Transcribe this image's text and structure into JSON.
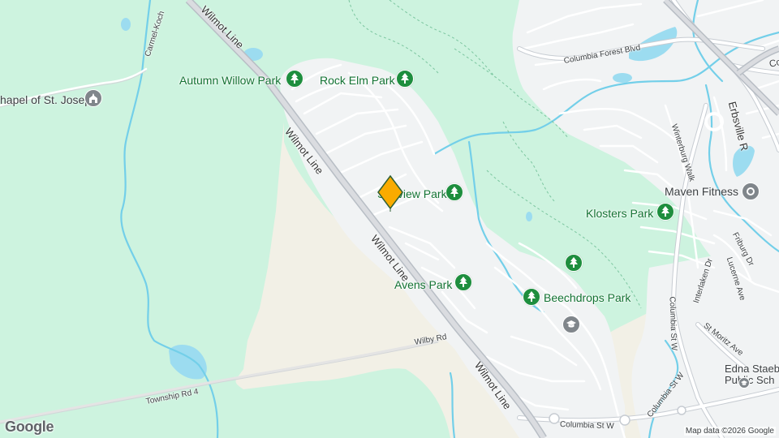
{
  "parks": [
    {
      "id": "autumn-willow",
      "label": "Autumn Willow Park"
    },
    {
      "id": "rock-elm",
      "label": "Rock Elm Park"
    },
    {
      "id": "sunview",
      "label": "Sunview Park"
    },
    {
      "id": "klosters",
      "label": "Klosters Park"
    },
    {
      "id": "avens",
      "label": "Avens Park"
    },
    {
      "id": "beechdrops",
      "label": "Beechdrops Park"
    }
  ],
  "pois": {
    "chapel": {
      "label": "hapel of St. Joseph",
      "icon": "chapel-icon"
    },
    "maven": {
      "label": "Maven Fitness",
      "icon": "fitness-icon"
    },
    "school": {
      "label_line1": "Edna Staeb",
      "label_line2": "Public Sch",
      "icon": "school-icon"
    }
  },
  "streets": {
    "wilmot_1": "Wilmot Line",
    "wilmot_2": "Wilmot Line",
    "wilmot_3": "Wilmot Line",
    "wilmot_4": "Wilmot Line",
    "carmel": "Carmel-Koch",
    "columbia_forest": "Columbia Forest Blvd",
    "erbsville": "Erbsville R",
    "co_top": "Co",
    "winterburg": "Winterburg Walk",
    "friburg": "Friburg Dr",
    "interlaken": "Interlaken Dr",
    "lucerne": "Lucerne Ave",
    "columbia_st_w_1": "Columbia St W",
    "columbia_st_w_2": "Columbia St W",
    "columbia_st_w_3": "Columbia St W",
    "st_moritz": "St Moritz Ave",
    "wilby": "Wilby Rd",
    "township": "Township Rd 4"
  },
  "attribution": "Map data ©2026 Google",
  "logo": "Google",
  "colors": {
    "forest": "#cdf3df",
    "farmland": "#f2f0e6",
    "urban": "#f1f3f4",
    "water": "#9cdcf0",
    "river": "#73cfe9",
    "road": "#ffffff",
    "road_outline": "#c7ccd2",
    "park_green": "#1e8e3e",
    "marker": "#f9ab00"
  }
}
